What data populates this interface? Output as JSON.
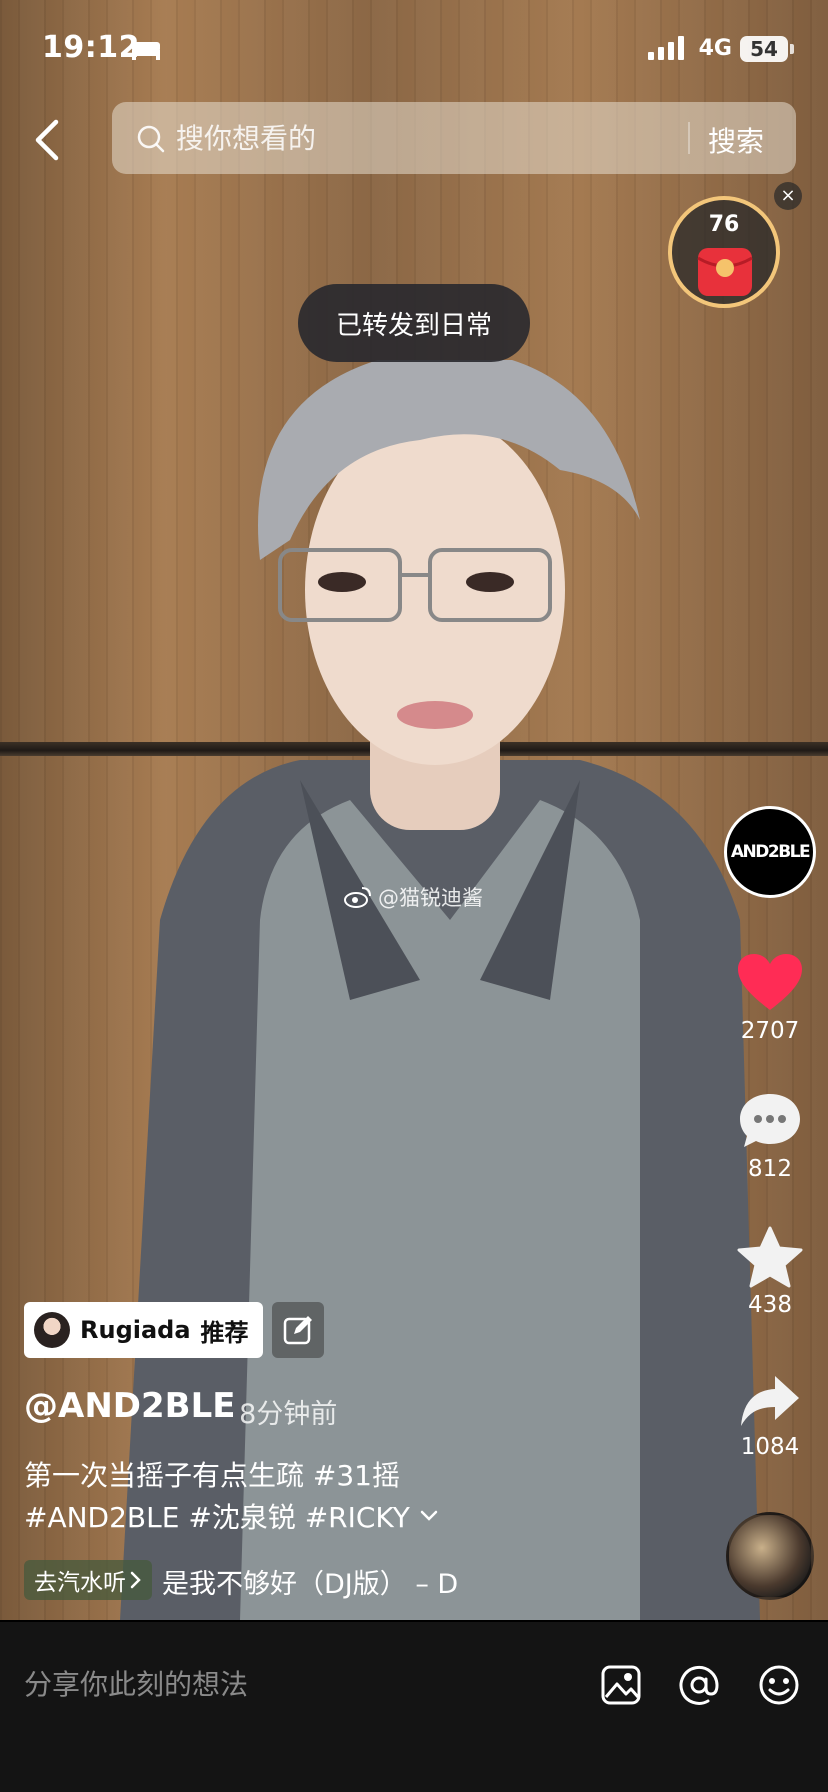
{
  "status": {
    "time": "19:12",
    "network": "4G",
    "battery": "54"
  },
  "search": {
    "placeholder": "搜你想看的",
    "button": "搜索"
  },
  "packet": {
    "count": "76",
    "close": "×"
  },
  "toast": "已转发到日常",
  "watermark": "@猫锐迪酱",
  "rail": {
    "brand_avatar": "AND2BLE",
    "likes": "2707",
    "comments": "812",
    "favorites": "438",
    "shares": "1084"
  },
  "post": {
    "recommender": "Rugiada",
    "recommend_suffix": "推荐",
    "author": "@AND2BLE",
    "time_ago": "· 8分钟前",
    "desc_line1": "第一次当摇子有点生疏 #31摇",
    "desc_line2": "#AND2BLE #沈泉锐 #RICKY",
    "music_tag": "去汽水听",
    "music_title": "是我不够好（DJ版） – D"
  },
  "composer": {
    "placeholder": "分享你此刻的想法"
  },
  "colors": {
    "like": "#ff2c55",
    "packet": "#e8313b",
    "packet_ring": "#f3c67a"
  }
}
